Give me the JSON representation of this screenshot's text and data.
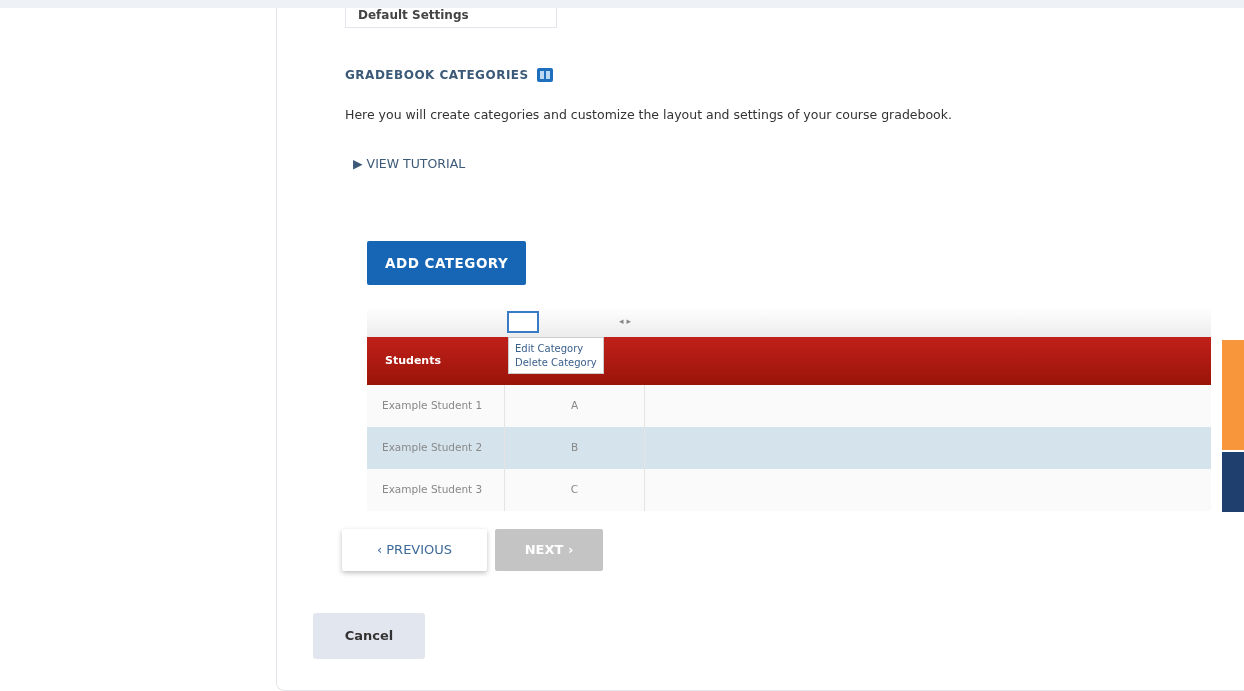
{
  "settings_field": {
    "value": "Default Settings"
  },
  "section": {
    "title": "GRADEBOOK CATEGORIES",
    "description": "Here you will create categories and customize the layout and settings of your course gradebook.",
    "tutorial_link": {
      "icon": "▶",
      "label": "VIEW TUTORIAL",
      "expanded": false
    }
  },
  "add_button": {
    "label": "ADD CATEGORY"
  },
  "table": {
    "columns": [
      "Students",
      ""
    ],
    "column_arrows": "◂ ▸",
    "menu": {
      "items": [
        "Edit Category",
        "Delete Category"
      ]
    },
    "rows": [
      {
        "student": "Example Student 1",
        "grade": "A",
        "highlighted": false
      },
      {
        "student": "Example Student 2",
        "grade": "B",
        "highlighted": true
      },
      {
        "student": "Example Student 3",
        "grade": "C",
        "highlighted": false
      }
    ]
  },
  "side_tabs": [
    {
      "color": "#f7963a"
    },
    {
      "color": "#1f3f6e"
    }
  ],
  "nav": {
    "previous": {
      "icon": "‹",
      "label": "PREVIOUS",
      "disabled": false
    },
    "next": {
      "icon": "›",
      "label": "NEXT",
      "disabled": true
    }
  },
  "cancel_button": {
    "label": "Cancel"
  }
}
